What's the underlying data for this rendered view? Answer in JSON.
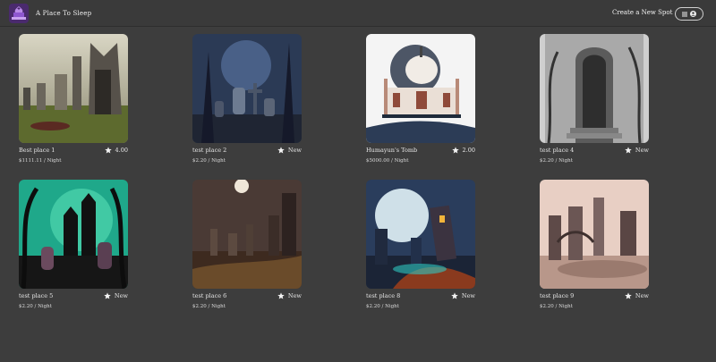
{
  "header": {
    "app_title": "A Place To Sleep",
    "create_spot": "Create a New Spot",
    "menu_icon": "hamburger-menu-icon",
    "user_icon": "user-circle-icon"
  },
  "spots": [
    {
      "name": "Best place 1",
      "rating": "4.00",
      "price": "$1111.11 / Night",
      "image": "graveyard-gothic-mausoleum"
    },
    {
      "name": "test place 2",
      "rating": "New",
      "price": "$2.20 / Night",
      "image": "dark-forest-cemetery"
    },
    {
      "name": "Humayun's Tomb",
      "rating": "2.00",
      "price": "$5000.00 / Night",
      "image": "humayuns-tomb-illustration"
    },
    {
      "name": "test place 4",
      "rating": "New",
      "price": "$2.20 / Night",
      "image": "sketched-crypt-doorway"
    },
    {
      "name": "test place 5",
      "rating": "New",
      "price": "$2.20 / Night",
      "image": "green-haunted-graveyard"
    },
    {
      "name": "test place 6",
      "rating": "New",
      "price": "$2.20 / Night",
      "image": "moonlit-ruined-cemetery"
    },
    {
      "name": "test place 8",
      "rating": "New",
      "price": "$2.20 / Night",
      "image": "cartoon-haunted-town"
    },
    {
      "name": "test place 9",
      "rating": "New",
      "price": "$2.20 / Night",
      "image": "ruined-gothic-plaza"
    }
  ],
  "colors": {
    "background": "#3d3d3d",
    "logo_accent": "#7b3fbf"
  }
}
